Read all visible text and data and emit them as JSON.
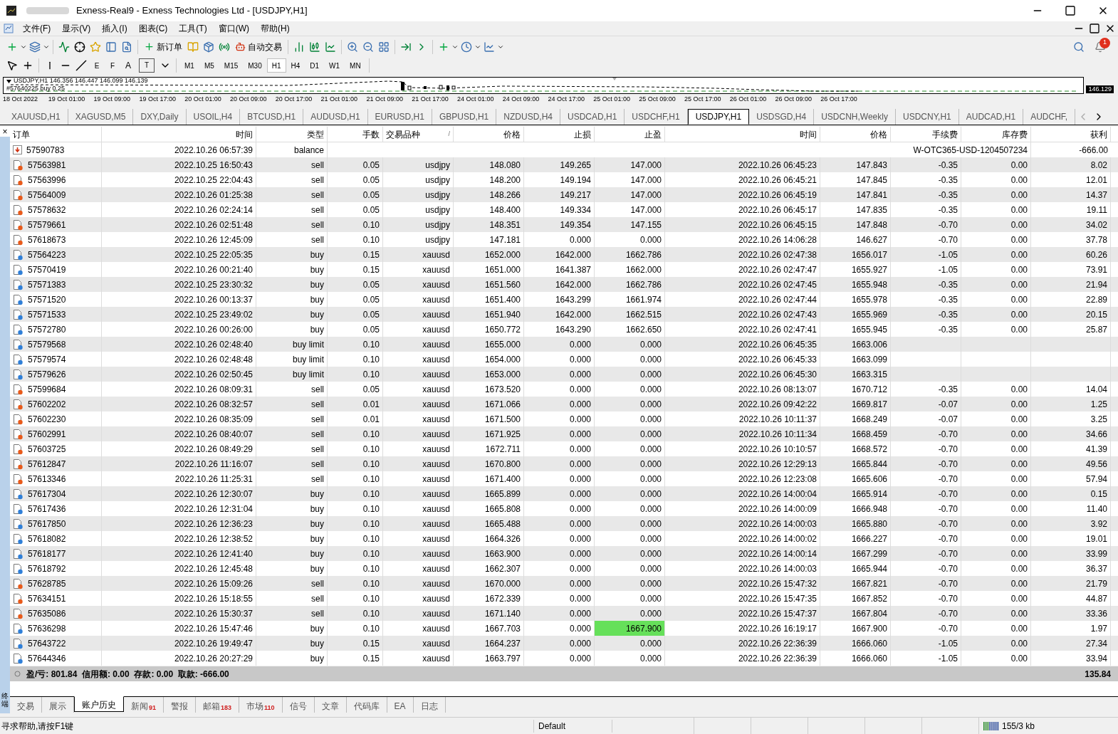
{
  "window": {
    "title": "Exness-Real9 - Exness Technologies Ltd - [USDJPY,H1]"
  },
  "menu": [
    "文件(F)",
    "显示(V)",
    "插入(I)",
    "图表(C)",
    "工具(T)",
    "窗口(W)",
    "帮助(H)"
  ],
  "toolbar": {
    "new_order": "新订单",
    "auto_trading": "自动交易",
    "notification_count": "1"
  },
  "draw_tools": [
    {
      "kind": "fibo_channel",
      "mark": "E"
    },
    {
      "kind": "fibo",
      "mark": "F"
    },
    {
      "kind": "text",
      "mark": "A"
    },
    {
      "kind": "label",
      "mark": "T"
    }
  ],
  "periods": [
    {
      "label": "M1",
      "selected": false
    },
    {
      "label": "M5",
      "selected": false
    },
    {
      "label": "M15",
      "selected": false
    },
    {
      "label": "M30",
      "selected": false
    },
    {
      "label": "H1",
      "selected": true
    },
    {
      "label": "H4",
      "selected": false
    },
    {
      "label": "D1",
      "selected": false
    },
    {
      "label": "W1",
      "selected": false
    },
    {
      "label": "MN",
      "selected": false
    }
  ],
  "chart": {
    "header": "USDJPY,H1  146.356 146.447 146.099 146.139",
    "order_label": "#57640225 buy 0.25",
    "price_tag": "146.129",
    "time_labels": [
      "18 Oct 2022",
      "19 Oct 01:00",
      "19 Oct 09:00",
      "19 Oct 17:00",
      "20 Oct 01:00",
      "20 Oct 09:00",
      "20 Oct 17:00",
      "21 Oct 01:00",
      "21 Oct 09:00",
      "21 Oct 17:00",
      "24 Oct 01:00",
      "24 Oct 09:00",
      "24 Oct 17:00",
      "25 Oct 01:00",
      "25 Oct 09:00",
      "25 Oct 17:00",
      "26 Oct 01:00",
      "26 Oct 09:00",
      "26 Oct 17:00"
    ]
  },
  "chart_tabs": [
    {
      "label": "XAUUSD,H1",
      "selected": false
    },
    {
      "label": "XAGUSD,M5",
      "selected": false
    },
    {
      "label": "DXY,Daily",
      "selected": false
    },
    {
      "label": "USOIL,H4",
      "selected": false
    },
    {
      "label": "BTCUSD,H1",
      "selected": false
    },
    {
      "label": "AUDUSD,H1",
      "selected": false
    },
    {
      "label": "EURUSD,H1",
      "selected": false
    },
    {
      "label": "GBPUSD,H1",
      "selected": false
    },
    {
      "label": "NZDUSD,H4",
      "selected": false
    },
    {
      "label": "USDCAD,H1",
      "selected": false
    },
    {
      "label": "USDCHF,H1",
      "selected": false
    },
    {
      "label": "USDJPY,H1",
      "selected": true
    },
    {
      "label": "USDSGD,H4",
      "selected": false
    },
    {
      "label": "USDCNH,Weekly",
      "selected": false
    },
    {
      "label": "USDCNY,H1",
      "selected": false
    },
    {
      "label": "AUDCAD,H1",
      "selected": false
    },
    {
      "label": "AUDCHF,",
      "selected": false
    }
  ],
  "terminal": {
    "side_label": "终端",
    "close": "×"
  },
  "table": {
    "columns": [
      "订单",
      "时间",
      "类型",
      "手数",
      "交易品种",
      "价格",
      "止损",
      "止盈",
      "时间",
      "价格",
      "手续费",
      "库存费",
      "获利"
    ],
    "sort_mark": "/",
    "rows": [
      {
        "kind": "balance",
        "cells": [
          "57590783",
          "2022.10.26 06:57:39",
          "balance"
        ],
        "comment": "W-OTC365-USD-1204507234",
        "profit": "-666.00"
      },
      {
        "kind": "sell",
        "tp_hit": false,
        "cells": [
          "57563981",
          "2022.10.25 16:50:43",
          "sell",
          "0.05",
          "usdjpy",
          "148.080",
          "149.265",
          "147.000",
          "2022.10.26 06:45:23",
          "147.843",
          "-0.35",
          "0.00",
          "8.02"
        ]
      },
      {
        "kind": "sell",
        "tp_hit": false,
        "cells": [
          "57563996",
          "2022.10.25 22:04:43",
          "sell",
          "0.05",
          "usdjpy",
          "148.200",
          "149.194",
          "147.000",
          "2022.10.26 06:45:21",
          "147.845",
          "-0.35",
          "0.00",
          "12.01"
        ]
      },
      {
        "kind": "sell",
        "tp_hit": false,
        "cells": [
          "57564009",
          "2022.10.26 01:25:38",
          "sell",
          "0.05",
          "usdjpy",
          "148.266",
          "149.217",
          "147.000",
          "2022.10.26 06:45:19",
          "147.841",
          "-0.35",
          "0.00",
          "14.37"
        ]
      },
      {
        "kind": "sell",
        "tp_hit": false,
        "cells": [
          "57578632",
          "2022.10.26 02:24:14",
          "sell",
          "0.05",
          "usdjpy",
          "148.400",
          "149.334",
          "147.000",
          "2022.10.26 06:45:17",
          "147.835",
          "-0.35",
          "0.00",
          "19.11"
        ]
      },
      {
        "kind": "sell",
        "tp_hit": false,
        "cells": [
          "57579661",
          "2022.10.26 02:51:48",
          "sell",
          "0.10",
          "usdjpy",
          "148.351",
          "149.354",
          "147.155",
          "2022.10.26 06:45:15",
          "147.848",
          "-0.70",
          "0.00",
          "34.02"
        ]
      },
      {
        "kind": "sell",
        "tp_hit": false,
        "cells": [
          "57618673",
          "2022.10.26 12:45:09",
          "sell",
          "0.10",
          "usdjpy",
          "147.181",
          "0.000",
          "0.000",
          "2022.10.26 14:06:28",
          "146.627",
          "-0.70",
          "0.00",
          "37.78"
        ]
      },
      {
        "kind": "buy",
        "tp_hit": false,
        "cells": [
          "57564223",
          "2022.10.25 22:05:35",
          "buy",
          "0.15",
          "xauusd",
          "1652.000",
          "1642.000",
          "1662.786",
          "2022.10.26 02:47:38",
          "1656.017",
          "-1.05",
          "0.00",
          "60.26"
        ]
      },
      {
        "kind": "buy",
        "tp_hit": false,
        "cells": [
          "57570419",
          "2022.10.26 00:21:40",
          "buy",
          "0.15",
          "xauusd",
          "1651.000",
          "1641.387",
          "1662.000",
          "2022.10.26 02:47:47",
          "1655.927",
          "-1.05",
          "0.00",
          "73.91"
        ]
      },
      {
        "kind": "buy",
        "tp_hit": false,
        "cells": [
          "57571383",
          "2022.10.25 23:30:32",
          "buy",
          "0.05",
          "xauusd",
          "1651.560",
          "1642.000",
          "1662.786",
          "2022.10.26 02:47:45",
          "1655.948",
          "-0.35",
          "0.00",
          "21.94"
        ]
      },
      {
        "kind": "buy",
        "tp_hit": false,
        "cells": [
          "57571520",
          "2022.10.26 00:13:37",
          "buy",
          "0.05",
          "xauusd",
          "1651.400",
          "1643.299",
          "1661.974",
          "2022.10.26 02:47:44",
          "1655.978",
          "-0.35",
          "0.00",
          "22.89"
        ]
      },
      {
        "kind": "buy",
        "tp_hit": false,
        "cells": [
          "57571533",
          "2022.10.25 23:49:02",
          "buy",
          "0.05",
          "xauusd",
          "1651.940",
          "1642.000",
          "1662.515",
          "2022.10.26 02:47:43",
          "1655.969",
          "-0.35",
          "0.00",
          "20.15"
        ]
      },
      {
        "kind": "buy",
        "tp_hit": false,
        "cells": [
          "57572780",
          "2022.10.26 00:26:00",
          "buy",
          "0.05",
          "xauusd",
          "1650.772",
          "1643.290",
          "1662.650",
          "2022.10.26 02:47:41",
          "1655.945",
          "-0.35",
          "0.00",
          "25.87"
        ]
      },
      {
        "kind": "pending",
        "tp_hit": false,
        "cells": [
          "57579568",
          "2022.10.26 02:48:40",
          "buy limit",
          "0.10",
          "xauusd",
          "1655.000",
          "0.000",
          "0.000",
          "2022.10.26 06:45:35",
          "1663.006"
        ]
      },
      {
        "kind": "pending",
        "tp_hit": false,
        "cells": [
          "57579574",
          "2022.10.26 02:48:48",
          "buy limit",
          "0.10",
          "xauusd",
          "1654.000",
          "0.000",
          "0.000",
          "2022.10.26 06:45:33",
          "1663.099"
        ]
      },
      {
        "kind": "pending",
        "tp_hit": false,
        "cells": [
          "57579626",
          "2022.10.26 02:50:45",
          "buy limit",
          "0.10",
          "xauusd",
          "1653.000",
          "0.000",
          "0.000",
          "2022.10.26 06:45:30",
          "1663.315"
        ]
      },
      {
        "kind": "sell",
        "tp_hit": false,
        "cells": [
          "57599684",
          "2022.10.26 08:09:31",
          "sell",
          "0.05",
          "xauusd",
          "1673.520",
          "0.000",
          "0.000",
          "2022.10.26 08:13:07",
          "1670.712",
          "-0.35",
          "0.00",
          "14.04"
        ]
      },
      {
        "kind": "sell",
        "tp_hit": false,
        "cells": [
          "57602202",
          "2022.10.26 08:32:57",
          "sell",
          "0.01",
          "xauusd",
          "1671.066",
          "0.000",
          "0.000",
          "2022.10.26 09:42:22",
          "1669.817",
          "-0.07",
          "0.00",
          "1.25"
        ]
      },
      {
        "kind": "sell",
        "tp_hit": false,
        "cells": [
          "57602230",
          "2022.10.26 08:35:09",
          "sell",
          "0.01",
          "xauusd",
          "1671.500",
          "0.000",
          "0.000",
          "2022.10.26 10:11:37",
          "1668.249",
          "-0.07",
          "0.00",
          "3.25"
        ]
      },
      {
        "kind": "sell",
        "tp_hit": false,
        "cells": [
          "57602991",
          "2022.10.26 08:40:07",
          "sell",
          "0.10",
          "xauusd",
          "1671.925",
          "0.000",
          "0.000",
          "2022.10.26 10:11:34",
          "1668.459",
          "-0.70",
          "0.00",
          "34.66"
        ]
      },
      {
        "kind": "sell",
        "tp_hit": false,
        "cells": [
          "57603725",
          "2022.10.26 08:49:29",
          "sell",
          "0.10",
          "xauusd",
          "1672.711",
          "0.000",
          "0.000",
          "2022.10.26 10:10:57",
          "1668.572",
          "-0.70",
          "0.00",
          "41.39"
        ]
      },
      {
        "kind": "sell",
        "tp_hit": false,
        "cells": [
          "57612847",
          "2022.10.26 11:16:07",
          "sell",
          "0.10",
          "xauusd",
          "1670.800",
          "0.000",
          "0.000",
          "2022.10.26 12:29:13",
          "1665.844",
          "-0.70",
          "0.00",
          "49.56"
        ]
      },
      {
        "kind": "sell",
        "tp_hit": false,
        "cells": [
          "57613346",
          "2022.10.26 11:25:31",
          "sell",
          "0.10",
          "xauusd",
          "1671.400",
          "0.000",
          "0.000",
          "2022.10.26 12:23:08",
          "1665.606",
          "-0.70",
          "0.00",
          "57.94"
        ]
      },
      {
        "kind": "buy",
        "tp_hit": false,
        "cells": [
          "57617304",
          "2022.10.26 12:30:07",
          "buy",
          "0.10",
          "xauusd",
          "1665.899",
          "0.000",
          "0.000",
          "2022.10.26 14:00:04",
          "1665.914",
          "-0.70",
          "0.00",
          "0.15"
        ]
      },
      {
        "kind": "buy",
        "tp_hit": false,
        "cells": [
          "57617436",
          "2022.10.26 12:31:04",
          "buy",
          "0.10",
          "xauusd",
          "1665.808",
          "0.000",
          "0.000",
          "2022.10.26 14:00:09",
          "1666.948",
          "-0.70",
          "0.00",
          "11.40"
        ]
      },
      {
        "kind": "buy",
        "tp_hit": false,
        "cells": [
          "57617850",
          "2022.10.26 12:36:23",
          "buy",
          "0.10",
          "xauusd",
          "1665.488",
          "0.000",
          "0.000",
          "2022.10.26 14:00:03",
          "1665.880",
          "-0.70",
          "0.00",
          "3.92"
        ]
      },
      {
        "kind": "buy",
        "tp_hit": false,
        "cells": [
          "57618082",
          "2022.10.26 12:38:52",
          "buy",
          "0.10",
          "xauusd",
          "1664.326",
          "0.000",
          "0.000",
          "2022.10.26 14:00:02",
          "1666.227",
          "-0.70",
          "0.00",
          "19.01"
        ]
      },
      {
        "kind": "buy",
        "tp_hit": false,
        "cells": [
          "57618177",
          "2022.10.26 12:41:40",
          "buy",
          "0.10",
          "xauusd",
          "1663.900",
          "0.000",
          "0.000",
          "2022.10.26 14:00:14",
          "1667.299",
          "-0.70",
          "0.00",
          "33.99"
        ]
      },
      {
        "kind": "buy",
        "tp_hit": false,
        "cells": [
          "57618792",
          "2022.10.26 12:45:48",
          "buy",
          "0.10",
          "xauusd",
          "1662.307",
          "0.000",
          "0.000",
          "2022.10.26 14:00:03",
          "1665.944",
          "-0.70",
          "0.00",
          "36.37"
        ]
      },
      {
        "kind": "sell",
        "tp_hit": false,
        "cells": [
          "57628785",
          "2022.10.26 15:09:26",
          "sell",
          "0.10",
          "xauusd",
          "1670.000",
          "0.000",
          "0.000",
          "2022.10.26 15:47:32",
          "1667.821",
          "-0.70",
          "0.00",
          "21.79"
        ]
      },
      {
        "kind": "sell",
        "tp_hit": false,
        "cells": [
          "57634151",
          "2022.10.26 15:18:55",
          "sell",
          "0.10",
          "xauusd",
          "1672.339",
          "0.000",
          "0.000",
          "2022.10.26 15:47:35",
          "1667.852",
          "-0.70",
          "0.00",
          "44.87"
        ]
      },
      {
        "kind": "sell",
        "tp_hit": false,
        "cells": [
          "57635086",
          "2022.10.26 15:30:37",
          "sell",
          "0.10",
          "xauusd",
          "1671.140",
          "0.000",
          "0.000",
          "2022.10.26 15:47:37",
          "1667.804",
          "-0.70",
          "0.00",
          "33.36"
        ]
      },
      {
        "kind": "buy",
        "tp_hit": true,
        "cells": [
          "57636298",
          "2022.10.26 15:47:46",
          "buy",
          "0.10",
          "xauusd",
          "1667.703",
          "0.000",
          "1667.900",
          "2022.10.26 16:19:17",
          "1667.900",
          "-0.70",
          "0.00",
          "1.97"
        ]
      },
      {
        "kind": "buy",
        "tp_hit": false,
        "cells": [
          "57643722",
          "2022.10.26 19:49:47",
          "buy",
          "0.15",
          "xauusd",
          "1664.237",
          "0.000",
          "0.000",
          "2022.10.26 22:36:39",
          "1666.060",
          "-1.05",
          "0.00",
          "27.34"
        ]
      },
      {
        "kind": "buy",
        "tp_hit": false,
        "cells": [
          "57644346",
          "2022.10.26 20:27:29",
          "buy",
          "0.15",
          "xauusd",
          "1663.797",
          "0.000",
          "0.000",
          "2022.10.26 22:36:39",
          "1666.060",
          "-1.05",
          "0.00",
          "33.94"
        ]
      }
    ],
    "summary": "盈/亏: 801.84  信用额: 0.00  存款: 0.00  取款: -666.00",
    "summary_total": "135.84"
  },
  "terminal_tabs": [
    {
      "label": "交易",
      "selected": false
    },
    {
      "label": "展示",
      "selected": false
    },
    {
      "label": "账户历史",
      "selected": true
    },
    {
      "label": "新闻",
      "badge": "91",
      "selected": false
    },
    {
      "label": "警报",
      "selected": false
    },
    {
      "label": "邮箱",
      "badge": "183",
      "selected": false
    },
    {
      "label": "市场",
      "badge": "110",
      "selected": false
    },
    {
      "label": "信号",
      "selected": false
    },
    {
      "label": "文章",
      "selected": false
    },
    {
      "label": "代码库",
      "selected": false
    },
    {
      "label": "EA",
      "selected": false
    },
    {
      "label": "日志",
      "selected": false
    }
  ],
  "status_bar": {
    "help": "寻求帮助,请按F1键",
    "profile": "Default",
    "traffic": "155/3 kb"
  }
}
